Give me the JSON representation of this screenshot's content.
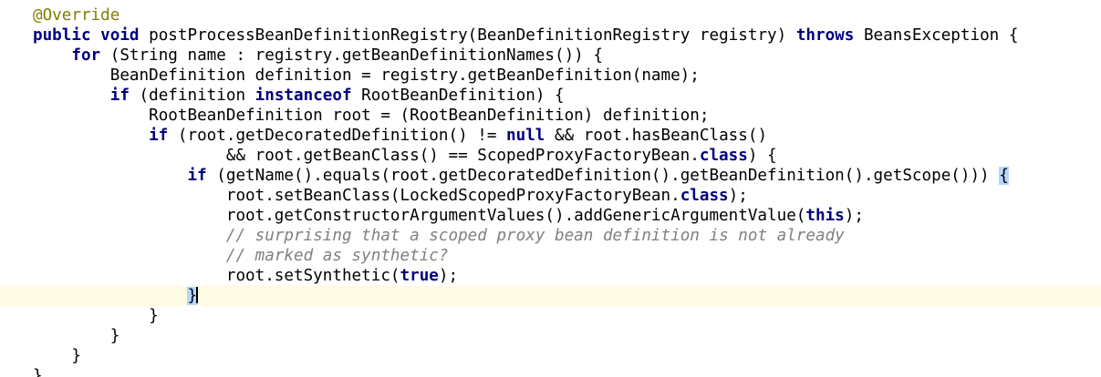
{
  "editor": {
    "language": "java",
    "current_line_color": "#fffae3",
    "matched_brace_color": "#b4d7ff",
    "keyword_color": "#000080",
    "annotation_color": "#808000",
    "comment_color": "#808080",
    "lines": [
      [
        {
          "t": "ann",
          "v": "@Override"
        }
      ],
      [
        {
          "t": "kw",
          "v": "public"
        },
        {
          "t": "",
          "v": " "
        },
        {
          "t": "kw",
          "v": "void"
        },
        {
          "t": "",
          "v": " postProcessBeanDefinitionRegistry(BeanDefinitionRegistry registry) "
        },
        {
          "t": "kw",
          "v": "throws"
        },
        {
          "t": "",
          "v": " BeansException {"
        }
      ],
      [
        {
          "t": "",
          "v": "    "
        },
        {
          "t": "kw",
          "v": "for"
        },
        {
          "t": "",
          "v": " (String name : registry.getBeanDefinitionNames()) {"
        }
      ],
      [
        {
          "t": "",
          "v": "        BeanDefinition definition = registry.getBeanDefinition(name);"
        }
      ],
      [
        {
          "t": "",
          "v": "        "
        },
        {
          "t": "kw",
          "v": "if"
        },
        {
          "t": "",
          "v": " (definition "
        },
        {
          "t": "kw",
          "v": "instanceof"
        },
        {
          "t": "",
          "v": " RootBeanDefinition) {"
        }
      ],
      [
        {
          "t": "",
          "v": "            RootBeanDefinition root = (RootBeanDefinition) definition;"
        }
      ],
      [
        {
          "t": "",
          "v": "            "
        },
        {
          "t": "kw",
          "v": "if"
        },
        {
          "t": "",
          "v": " (root.getDecoratedDefinition() != "
        },
        {
          "t": "kw",
          "v": "null"
        },
        {
          "t": "",
          "v": " && root.hasBeanClass()"
        }
      ],
      [
        {
          "t": "",
          "v": "                    && root.getBeanClass() == ScopedProxyFactoryBean."
        },
        {
          "t": "kw",
          "v": "class"
        },
        {
          "t": "",
          "v": ") {"
        }
      ],
      [
        {
          "t": "",
          "v": "                "
        },
        {
          "t": "kw",
          "v": "if"
        },
        {
          "t": "",
          "v": " (getName().equals(root.getDecoratedDefinition().getBeanDefinition().getScope())) "
        },
        {
          "t": "hl",
          "v": "{"
        }
      ],
      [
        {
          "t": "",
          "v": "                    root.setBeanClass(LockedScopedProxyFactoryBean."
        },
        {
          "t": "kw",
          "v": "class"
        },
        {
          "t": "",
          "v": ");"
        }
      ],
      [
        {
          "t": "",
          "v": "                    root.getConstructorArgumentValues().addGenericArgumentValue("
        },
        {
          "t": "kw",
          "v": "this"
        },
        {
          "t": "",
          "v": ");"
        }
      ],
      [
        {
          "t": "",
          "v": "                    "
        },
        {
          "t": "cm",
          "v": "// surprising that a scoped proxy bean definition is not already"
        }
      ],
      [
        {
          "t": "",
          "v": "                    "
        },
        {
          "t": "cm",
          "v": "// marked as synthetic?"
        }
      ],
      [
        {
          "t": "",
          "v": "                    root.setSynthetic("
        },
        {
          "t": "kw",
          "v": "true"
        },
        {
          "t": "",
          "v": ");"
        }
      ],
      [
        {
          "t": "",
          "v": "                "
        },
        {
          "t": "hl",
          "v": "}"
        },
        {
          "t": "caret",
          "v": ""
        }
      ],
      [
        {
          "t": "",
          "v": "            }"
        }
      ],
      [
        {
          "t": "",
          "v": "        }"
        }
      ],
      [
        {
          "t": "",
          "v": "    }"
        }
      ],
      [
        {
          "t": "",
          "v": "}"
        }
      ]
    ],
    "current_line": 14
  }
}
